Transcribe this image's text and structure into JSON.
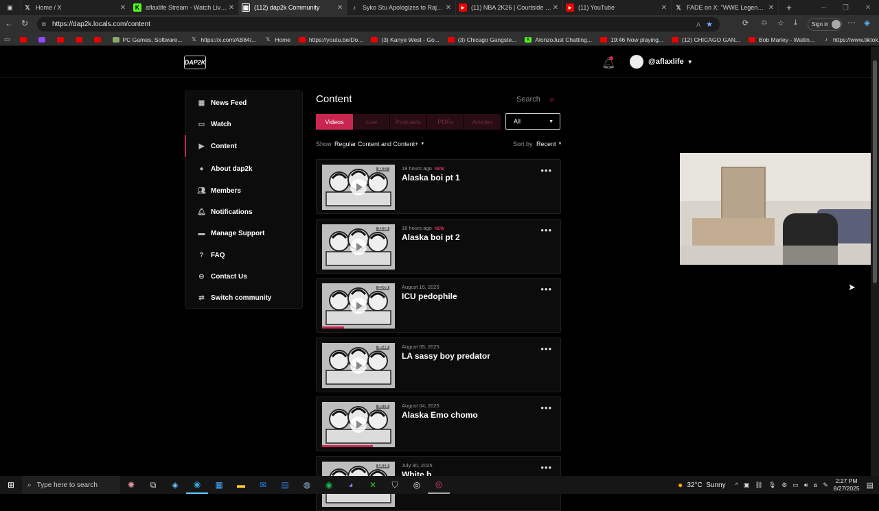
{
  "browser": {
    "tabs": [
      {
        "title": "Home / X",
        "icon": "x-logo-icon",
        "active": false
      },
      {
        "title": "aflaxlife Stream - Watch Live on K",
        "icon": "kick-logo-icon",
        "active": false
      },
      {
        "title": "(112) dap2k Community",
        "icon": "locals-logo-icon",
        "active": true
      },
      {
        "title": "Syko Stu Apologizes to Raja Jack",
        "icon": "tiktok-logo-icon",
        "active": false
      },
      {
        "title": "(11) NBA 2K26 | Courtside Repor",
        "icon": "youtube-logo-icon",
        "active": false
      },
      {
        "title": "(11) YouTube",
        "icon": "youtube-logo-icon",
        "active": false
      },
      {
        "title": "FADE on X: \"WWE Legend Mark",
        "icon": "x-logo-icon",
        "active": false
      }
    ],
    "url": "https://dap2k.locals.com/content",
    "signin_label": "Sign in",
    "bookmarks": [
      {
        "label": "",
        "icon": "youtube-icon"
      },
      {
        "label": "",
        "icon": "twitch-icon"
      },
      {
        "label": "",
        "icon": "youtube-icon"
      },
      {
        "label": "",
        "icon": "youtube-icon"
      },
      {
        "label": "",
        "icon": "youtube-icon"
      },
      {
        "label": "PC Games, Software...",
        "icon": "site-icon"
      },
      {
        "label": "https://x.com/AB84/...",
        "icon": "x-logo-icon"
      },
      {
        "label": "Home",
        "icon": "x-logo-icon"
      },
      {
        "label": "https://youtu.be/Do...",
        "icon": "youtube-icon"
      },
      {
        "label": "(3) Kanye West - Go...",
        "icon": "youtube-icon"
      },
      {
        "label": "(3) Chicago Gangste...",
        "icon": "youtube-icon"
      },
      {
        "label": "AlonzoJust Chatting...",
        "icon": "kick-logo-icon"
      },
      {
        "label": "19:46 Now playing...",
        "icon": "youtube-icon"
      },
      {
        "label": "(12) CHICAGO GAN...",
        "icon": "youtube-icon"
      },
      {
        "label": "Bob Marley - Waitin...",
        "icon": "youtube-icon"
      },
      {
        "label": "https://www.tiktok.c...",
        "icon": "tiktok-logo-icon"
      }
    ]
  },
  "site": {
    "logo_text": "DAP2K",
    "username": "@aflaxlife"
  },
  "sidebar": {
    "items": [
      {
        "label": "News Feed",
        "icon": "grid-icon",
        "active": false
      },
      {
        "label": "Watch",
        "icon": "tv-icon",
        "active": false
      },
      {
        "label": "Content",
        "icon": "play-icon",
        "active": true
      },
      {
        "label": "About dap2k",
        "icon": "avatar-icon",
        "active": false
      },
      {
        "label": "Members",
        "icon": "members-icon",
        "active": false
      },
      {
        "label": "Notifications",
        "icon": "bell-icon",
        "active": false
      },
      {
        "label": "Manage Support",
        "icon": "card-icon",
        "active": false
      },
      {
        "label": "FAQ",
        "icon": "question-icon",
        "active": false
      },
      {
        "label": "Contact Us",
        "icon": "contact-icon",
        "active": false
      },
      {
        "label": "Switch community",
        "icon": "switch-icon",
        "active": false
      }
    ]
  },
  "content": {
    "title": "Content",
    "search_label": "Search",
    "filter_tabs": [
      {
        "label": "Videos",
        "active": true
      },
      {
        "label": "Live",
        "active": false
      },
      {
        "label": "Podcasts",
        "active": false
      },
      {
        "label": "PDFs",
        "active": false
      },
      {
        "label": "Articles",
        "active": false
      }
    ],
    "scope_select": "All",
    "show_label": "Show",
    "show_value": "Regular Content and Content+",
    "sort_label": "Sort by",
    "sort_value": "Recent",
    "posts": [
      {
        "date": "18 hours ago",
        "new": "NEW",
        "title": "Alaska boi pt 1",
        "duration": "33:27",
        "progress": 0
      },
      {
        "date": "18 hours ago",
        "new": "NEW",
        "title": "Alaska boi pt 2",
        "duration": "03:38",
        "progress": 0
      },
      {
        "date": "August 15, 2025",
        "new": "",
        "title": "ICU pedophile",
        "duration": "25:09",
        "progress": 0.3
      },
      {
        "date": "August 05, 2025",
        "new": "",
        "title": "LA sassy boy predator",
        "duration": "38:48",
        "progress": 0
      },
      {
        "date": "August 04, 2025",
        "new": "",
        "title": "Alaska Emo chomo",
        "duration": "39:18",
        "progress": 0.7
      },
      {
        "date": "July 30, 2025",
        "new": "",
        "title": "White b...",
        "duration": "18:19",
        "progress": 0
      }
    ]
  },
  "taskbar": {
    "search_placeholder": "Type here to search",
    "weather": "32°C  Sunny",
    "time": "2:27 PM",
    "date": "8/27/2025"
  },
  "colors": {
    "accent": "#c8264f",
    "background": "#000000",
    "card": "#0c0c0c"
  }
}
